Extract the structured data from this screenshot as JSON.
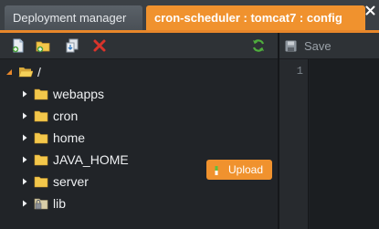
{
  "tabs": [
    {
      "label": "Deployment manager",
      "active": false
    },
    {
      "label": "cron-scheduler : tomcat7 : config",
      "active": true
    }
  ],
  "toolbar": {
    "icons": [
      "new-file-icon",
      "new-folder-icon",
      "add-mount-icon",
      "delete-icon",
      "refresh-icon"
    ]
  },
  "tree": {
    "root": {
      "label": "/",
      "expanded": true
    },
    "items": [
      {
        "label": "webapps",
        "icon": "folder-icon"
      },
      {
        "label": "cron",
        "icon": "folder-icon"
      },
      {
        "label": "home",
        "icon": "folder-icon"
      },
      {
        "label": "JAVA_HOME",
        "icon": "folder-icon"
      },
      {
        "label": "server",
        "icon": "folder-icon"
      },
      {
        "label": "lib",
        "icon": "folder-lock-icon"
      }
    ]
  },
  "upload": {
    "label": "Upload"
  },
  "editor": {
    "save_label": "Save",
    "line_numbers": [
      "1"
    ]
  },
  "colors": {
    "accent": "#f0922e",
    "background": "#212428",
    "folder": "#f3c74b"
  }
}
